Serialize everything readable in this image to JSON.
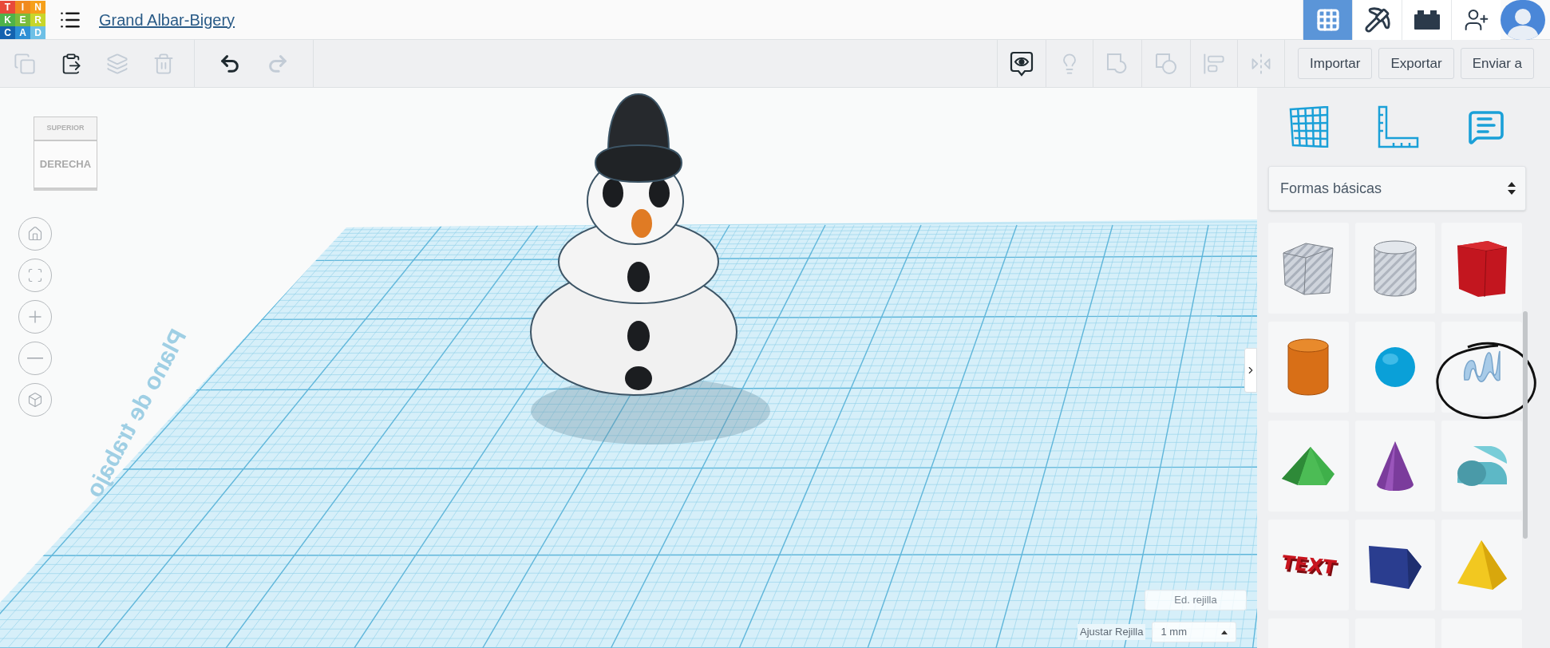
{
  "header": {
    "logo_letters": [
      "T",
      "I",
      "N",
      "K",
      "E",
      "R",
      "C",
      "A",
      "D"
    ],
    "design_title": "Grand Albar-Bigery",
    "view_buttons": [
      {
        "kind": "grid",
        "selected": true
      },
      {
        "kind": "pickaxe",
        "selected": false
      },
      {
        "kind": "bricks",
        "selected": false
      }
    ]
  },
  "toolbar": {
    "edit_tools": [
      {
        "kind": "copy",
        "disabled": true
      },
      {
        "kind": "paste",
        "disabled": false
      },
      {
        "kind": "duplicate",
        "disabled": true
      },
      {
        "kind": "delete",
        "disabled": true
      }
    ],
    "history_tools": [
      {
        "kind": "undo",
        "disabled": false
      },
      {
        "kind": "redo",
        "disabled": true
      }
    ],
    "view_tools": [
      {
        "kind": "notes",
        "disabled": false
      },
      {
        "kind": "bulb",
        "disabled": true
      },
      {
        "kind": "group",
        "disabled": true
      },
      {
        "kind": "ungroup",
        "disabled": true
      },
      {
        "kind": "align",
        "disabled": true
      },
      {
        "kind": "mirror",
        "disabled": true
      }
    ],
    "actions": [
      "Importar",
      "Exportar",
      "Enviar a"
    ]
  },
  "view_cube": {
    "front_face": "DERECHA",
    "top_face": "SUPERIOR"
  },
  "nav_controls": [
    {
      "kind": "home"
    },
    {
      "kind": "fit"
    },
    {
      "kind": "zoom-in"
    },
    {
      "kind": "zoom-out"
    },
    {
      "kind": "perspective"
    }
  ],
  "workplane": {
    "label": "Plano de trabajo"
  },
  "grid_controls": {
    "edit_button": "Ed. rejilla",
    "snap_label": "Ajustar Rejilla",
    "snap_value": "1 mm"
  },
  "panel": {
    "tools": [
      {
        "kind": "workplane"
      },
      {
        "kind": "ruler"
      },
      {
        "kind": "notes"
      }
    ],
    "library": "Formas básicas",
    "shapes": [
      {
        "kind": "box-hole"
      },
      {
        "kind": "cylinder-hole"
      },
      {
        "kind": "box"
      },
      {
        "kind": "cylinder"
      },
      {
        "kind": "sphere"
      },
      {
        "kind": "scribble",
        "circled": true
      },
      {
        "kind": "roof"
      },
      {
        "kind": "cone"
      },
      {
        "kind": "round-roof"
      },
      {
        "kind": "text",
        "text": "TEXT"
      },
      {
        "kind": "wedge"
      },
      {
        "kind": "pyramid"
      },
      {
        "kind": "empty"
      },
      {
        "kind": "empty"
      },
      {
        "kind": "empty"
      }
    ]
  }
}
